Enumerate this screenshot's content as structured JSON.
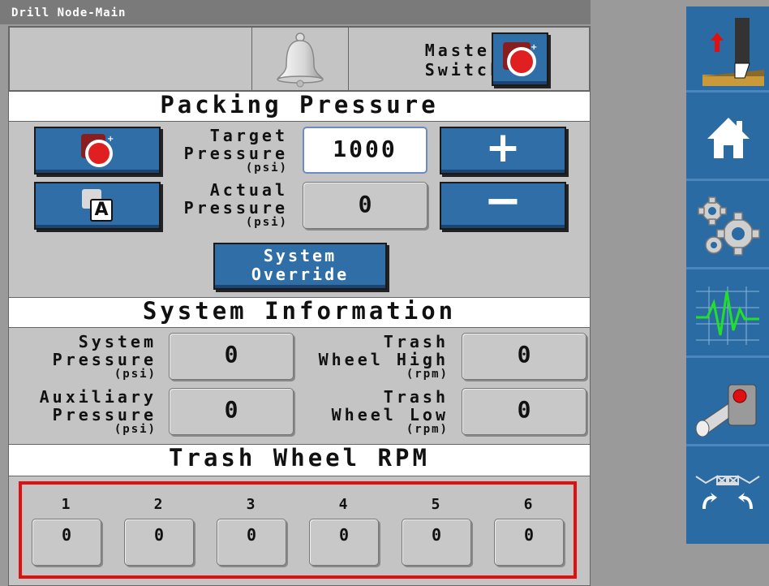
{
  "window": {
    "title": "Drill Node-Main"
  },
  "top": {
    "master_switch_label_1": "Master",
    "master_switch_label_2": "Switch"
  },
  "packing": {
    "header": "Packing Pressure",
    "target_label_1": "Target",
    "target_label_2": "Pressure",
    "target_unit": "(psi)",
    "target_value": "1000",
    "actual_label_1": "Actual",
    "actual_label_2": "Pressure",
    "actual_unit": "(psi)",
    "actual_value": "0",
    "plus_label": "+",
    "minus_label": "−",
    "manual_mode_label": "A",
    "override_line_1": "System",
    "override_line_2": "Override"
  },
  "system_info": {
    "header": "System Information",
    "sys_label_1": "System",
    "sys_label_2": "Pressure",
    "sys_unit": "(psi)",
    "sys_value": "0",
    "aux_label_1": "Auxiliary",
    "aux_label_2": "Pressure",
    "aux_unit": "(psi)",
    "aux_value": "0",
    "twh_label_1": "Trash",
    "twh_label_2": "Wheel High",
    "twh_unit": "(rpm)",
    "twh_value": "0",
    "twl_label_1": "Trash",
    "twl_label_2": "Wheel Low",
    "twl_unit": "(rpm)",
    "twl_value": "0"
  },
  "trash_rpm": {
    "header": "Trash Wheel RPM",
    "wheels": [
      {
        "num": "1",
        "value": "0"
      },
      {
        "num": "2",
        "value": "0"
      },
      {
        "num": "3",
        "value": "0"
      },
      {
        "num": "4",
        "value": "0"
      },
      {
        "num": "5",
        "value": "0"
      },
      {
        "num": "6",
        "value": "0"
      }
    ]
  },
  "sidebar": {
    "items": [
      {
        "icon": "raise-opener-icon"
      },
      {
        "icon": "home-icon"
      },
      {
        "icon": "settings-gears-icon"
      },
      {
        "icon": "diagnostics-waveform-icon"
      },
      {
        "icon": "hydraulic-lever-icon"
      },
      {
        "icon": "wing-fold-icon"
      }
    ]
  },
  "colors": {
    "accent_blue": "#2f6ea6",
    "highlight_red": "#e01010",
    "panel_gray": "#c4c4c4"
  }
}
